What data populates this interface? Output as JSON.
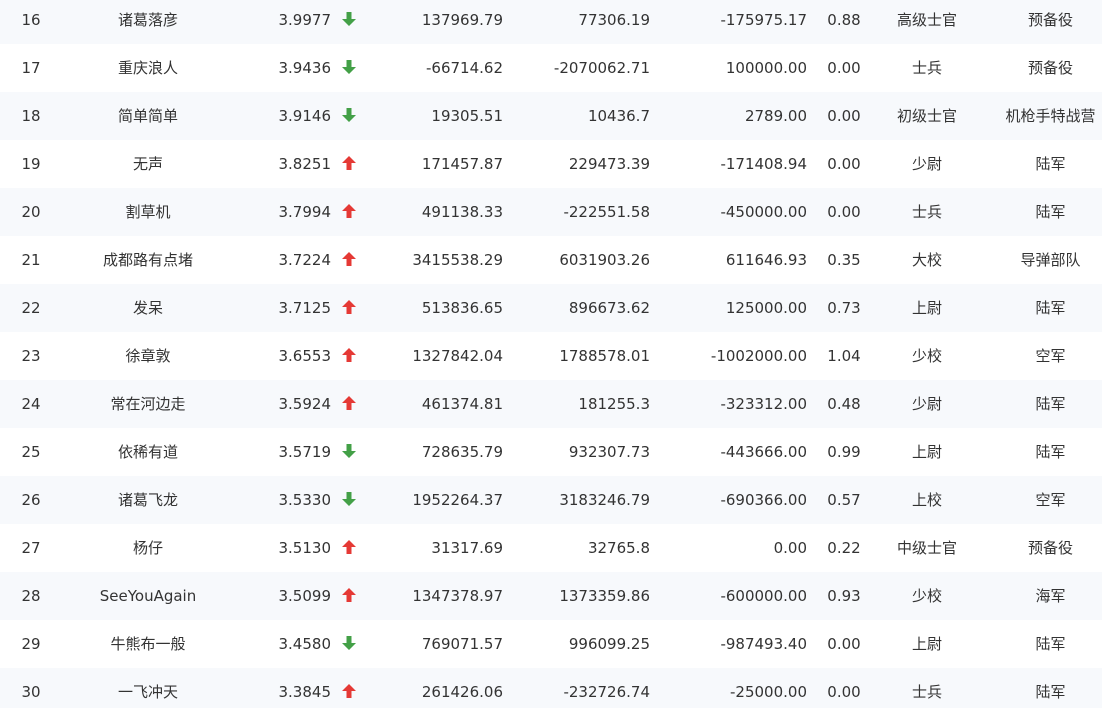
{
  "colors": {
    "up": "#e53935",
    "down": "#43a047",
    "text": "#333333",
    "stripe": "#f7f9fc"
  },
  "rows": [
    {
      "rank": "16",
      "name": "诸葛落彦",
      "score": "3.9977",
      "trend": "down",
      "v1": "137969.79",
      "v2": "77306.19",
      "v3": "-175975.17",
      "ratio": "0.88",
      "military_rank": "高级士官",
      "unit": "预备役"
    },
    {
      "rank": "17",
      "name": "重庆浪人",
      "score": "3.9436",
      "trend": "down",
      "v1": "-66714.62",
      "v2": "-2070062.71",
      "v3": "100000.00",
      "ratio": "0.00",
      "military_rank": "士兵",
      "unit": "预备役"
    },
    {
      "rank": "18",
      "name": "简单简单",
      "score": "3.9146",
      "trend": "down",
      "v1": "19305.51",
      "v2": "10436.7",
      "v3": "2789.00",
      "ratio": "0.00",
      "military_rank": "初级士官",
      "unit": "机枪手特战营"
    },
    {
      "rank": "19",
      "name": "无声",
      "score": "3.8251",
      "trend": "up",
      "v1": "171457.87",
      "v2": "229473.39",
      "v3": "-171408.94",
      "ratio": "0.00",
      "military_rank": "少尉",
      "unit": "陆军"
    },
    {
      "rank": "20",
      "name": "割草机",
      "score": "3.7994",
      "trend": "up",
      "v1": "491138.33",
      "v2": "-222551.58",
      "v3": "-450000.00",
      "ratio": "0.00",
      "military_rank": "士兵",
      "unit": "陆军"
    },
    {
      "rank": "21",
      "name": "成都路有点堵",
      "score": "3.7224",
      "trend": "up",
      "v1": "3415538.29",
      "v2": "6031903.26",
      "v3": "611646.93",
      "ratio": "0.35",
      "military_rank": "大校",
      "unit": "导弹部队"
    },
    {
      "rank": "22",
      "name": "发呆",
      "score": "3.7125",
      "trend": "up",
      "v1": "513836.65",
      "v2": "896673.62",
      "v3": "125000.00",
      "ratio": "0.73",
      "military_rank": "上尉",
      "unit": "陆军"
    },
    {
      "rank": "23",
      "name": "徐章敦",
      "score": "3.6553",
      "trend": "up",
      "v1": "1327842.04",
      "v2": "1788578.01",
      "v3": "-1002000.00",
      "ratio": "1.04",
      "military_rank": "少校",
      "unit": "空军"
    },
    {
      "rank": "24",
      "name": "常在河边走",
      "score": "3.5924",
      "trend": "up",
      "v1": "461374.81",
      "v2": "181255.3",
      "v3": "-323312.00",
      "ratio": "0.48",
      "military_rank": "少尉",
      "unit": "陆军"
    },
    {
      "rank": "25",
      "name": "依稀有道",
      "score": "3.5719",
      "trend": "down",
      "v1": "728635.79",
      "v2": "932307.73",
      "v3": "-443666.00",
      "ratio": "0.99",
      "military_rank": "上尉",
      "unit": "陆军"
    },
    {
      "rank": "26",
      "name": "诸葛飞龙",
      "score": "3.5330",
      "trend": "down",
      "v1": "1952264.37",
      "v2": "3183246.79",
      "v3": "-690366.00",
      "ratio": "0.57",
      "military_rank": "上校",
      "unit": "空军"
    },
    {
      "rank": "27",
      "name": "杨仔",
      "score": "3.5130",
      "trend": "up",
      "v1": "31317.69",
      "v2": "32765.8",
      "v3": "0.00",
      "ratio": "0.22",
      "military_rank": "中级士官",
      "unit": "预备役"
    },
    {
      "rank": "28",
      "name": "SeeYouAgain",
      "score": "3.5099",
      "trend": "up",
      "v1": "1347378.97",
      "v2": "1373359.86",
      "v3": "-600000.00",
      "ratio": "0.93",
      "military_rank": "少校",
      "unit": "海军"
    },
    {
      "rank": "29",
      "name": "牛熊布一般",
      "score": "3.4580",
      "trend": "down",
      "v1": "769071.57",
      "v2": "996099.25",
      "v3": "-987493.40",
      "ratio": "0.00",
      "military_rank": "上尉",
      "unit": "陆军"
    },
    {
      "rank": "30",
      "name": "一飞冲天",
      "score": "3.3845",
      "trend": "up",
      "v1": "261426.06",
      "v2": "-232726.74",
      "v3": "-25000.00",
      "ratio": "0.00",
      "military_rank": "士兵",
      "unit": "陆军"
    }
  ]
}
